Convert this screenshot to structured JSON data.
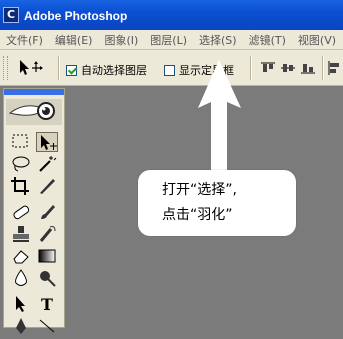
{
  "window": {
    "title": "Adobe Photoshop",
    "icon_letter": "C"
  },
  "menu": [
    {
      "label": "文件(F)"
    },
    {
      "label": "编辑(E)"
    },
    {
      "label": "图象(I)"
    },
    {
      "label": "图层(L)"
    },
    {
      "label": "选择(S)"
    },
    {
      "label": "滤镜(T)"
    },
    {
      "label": "视图(V)"
    }
  ],
  "options": {
    "auto_select_layer": {
      "label": "自动选择图层",
      "checked": true
    },
    "show_bounds": {
      "label": "显示定界框",
      "checked": false
    }
  },
  "callout": {
    "line1": "打开“选择”,",
    "line2": "点击“羽化”"
  },
  "colors": {
    "canvas": "#7b7b7b",
    "chrome": "#ece9d8",
    "titlebar": "#0b4fd2"
  }
}
